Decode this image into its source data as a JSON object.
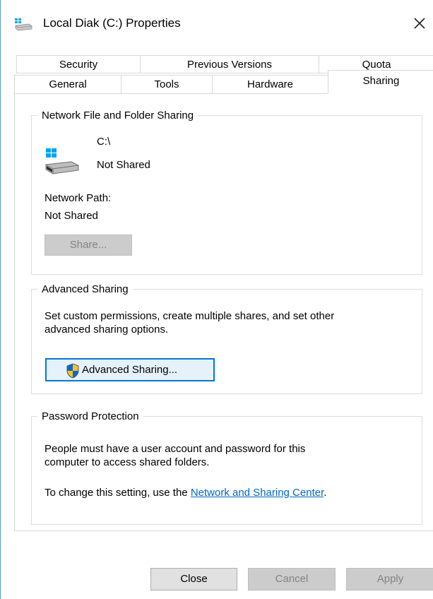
{
  "window": {
    "title": "Local Diak (C:) Properties"
  },
  "tabs": {
    "row1": [
      {
        "label": "Security"
      },
      {
        "label": "Previous Versions"
      },
      {
        "label": "Quota"
      }
    ],
    "row2": [
      {
        "label": "General"
      },
      {
        "label": "Tools"
      },
      {
        "label": "Hardware"
      },
      {
        "label": "Sharing",
        "selected": true
      }
    ]
  },
  "network_sharing": {
    "legend": "Network File and Folder Sharing",
    "drive_path": "C:\\",
    "drive_status": "Not Shared",
    "network_path_label": "Network Path:",
    "network_path_value": "Not Shared",
    "share_button": "Share..."
  },
  "advanced_sharing": {
    "legend": "Advanced Sharing",
    "description_line1": "Set custom permissions, create multiple shares, and set other",
    "description_line2": "advanced sharing options.",
    "button": "Advanced Sharing..."
  },
  "password_protection": {
    "legend": "Password Protection",
    "line1": "People must have a user account and password for this",
    "line2": "computer to access shared folders.",
    "change_prefix": "To change this setting, use the ",
    "link": "Network and Sharing Center",
    "change_suffix": "."
  },
  "footer": {
    "close": "Close",
    "cancel": "Cancel",
    "apply": "Apply"
  },
  "colors": {
    "accent": "#0078d7",
    "link": "#0066cc",
    "windows_logo": "#00a4ef",
    "shield_blue": "#1a63c6",
    "shield_yellow": "#f6c324"
  },
  "icons": [
    "drive-icon",
    "close-icon",
    "windows-drive-icon",
    "uac-shield-icon"
  ]
}
